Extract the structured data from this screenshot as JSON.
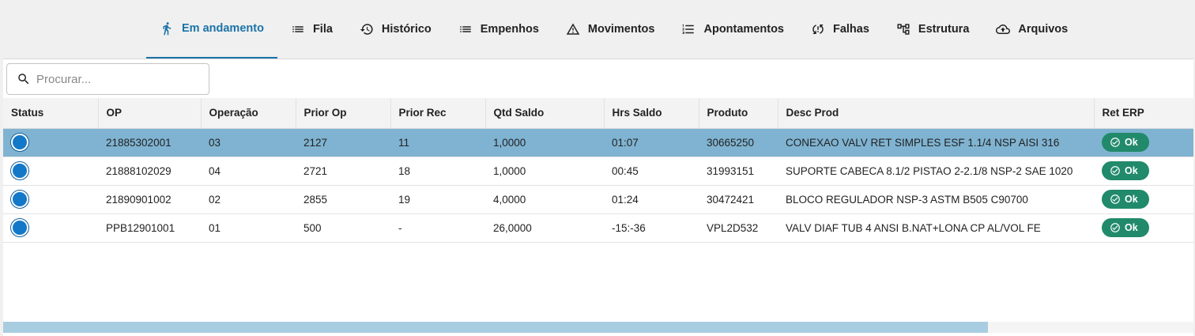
{
  "tabs": [
    {
      "label": "Em andamento",
      "icon": "running-icon"
    },
    {
      "label": "Fila",
      "icon": "list-icon"
    },
    {
      "label": "Histórico",
      "icon": "history-icon"
    },
    {
      "label": "Empenhos",
      "icon": "list-icon"
    },
    {
      "label": "Movimentos",
      "icon": "warning-icon"
    },
    {
      "label": "Apontamentos",
      "icon": "numbered-list-icon"
    },
    {
      "label": "Falhas",
      "icon": "sync-problem-icon"
    },
    {
      "label": "Estrutura",
      "icon": "hierarchy-icon"
    },
    {
      "label": "Arquivos",
      "icon": "cloud-upload-icon"
    }
  ],
  "active_tab": "Em andamento",
  "search": {
    "placeholder": "Procurar...",
    "value": ""
  },
  "table": {
    "columns": [
      "Status",
      "OP",
      "Operação",
      "Prior Op",
      "Prior Rec",
      "Qtd Saldo",
      "Hrs Saldo",
      "Produto",
      "Desc Prod",
      "Ret ERP"
    ],
    "rows": [
      {
        "op": "21885302001",
        "operacao": "03",
        "prior_op": "2127",
        "prior_rec": "11",
        "qtd_saldo": "1,0000",
        "hrs_saldo": "01:07",
        "produto": "30665250",
        "desc_prod": "CONEXAO VALV RET SIMPLES ESF 1.1/4 NSP AISI 316",
        "ret_erp": "Ok"
      },
      {
        "op": "21888102029",
        "operacao": "04",
        "prior_op": "2721",
        "prior_rec": "18",
        "qtd_saldo": "1,0000",
        "hrs_saldo": "00:45",
        "produto": "31993151",
        "desc_prod": "SUPORTE CABECA 8.1/2 PISTAO 2-2.1/8 NSP-2 SAE 1020",
        "ret_erp": "Ok"
      },
      {
        "op": "21890901002",
        "operacao": "02",
        "prior_op": "2855",
        "prior_rec": "19",
        "qtd_saldo": "4,0000",
        "hrs_saldo": "01:24",
        "produto": "30472421",
        "desc_prod": "BLOCO REGULADOR NSP-3 ASTM B505 C90700",
        "ret_erp": "Ok"
      },
      {
        "op": "PPB12901001",
        "operacao": "01",
        "prior_op": "500",
        "prior_rec": "-",
        "qtd_saldo": "26,0000",
        "hrs_saldo": "-15:-36",
        "produto": "VPL2D532",
        "desc_prod": "VALV DIAF TUB 4 ANSI B.NAT+LONA CP AL/VOL FE",
        "ret_erp": "Ok"
      }
    ]
  },
  "colors": {
    "accent": "#1b73a8",
    "selected_row": "#7fb3d1",
    "status_dot": "#1478c8",
    "ok_badge": "#218a6a"
  }
}
